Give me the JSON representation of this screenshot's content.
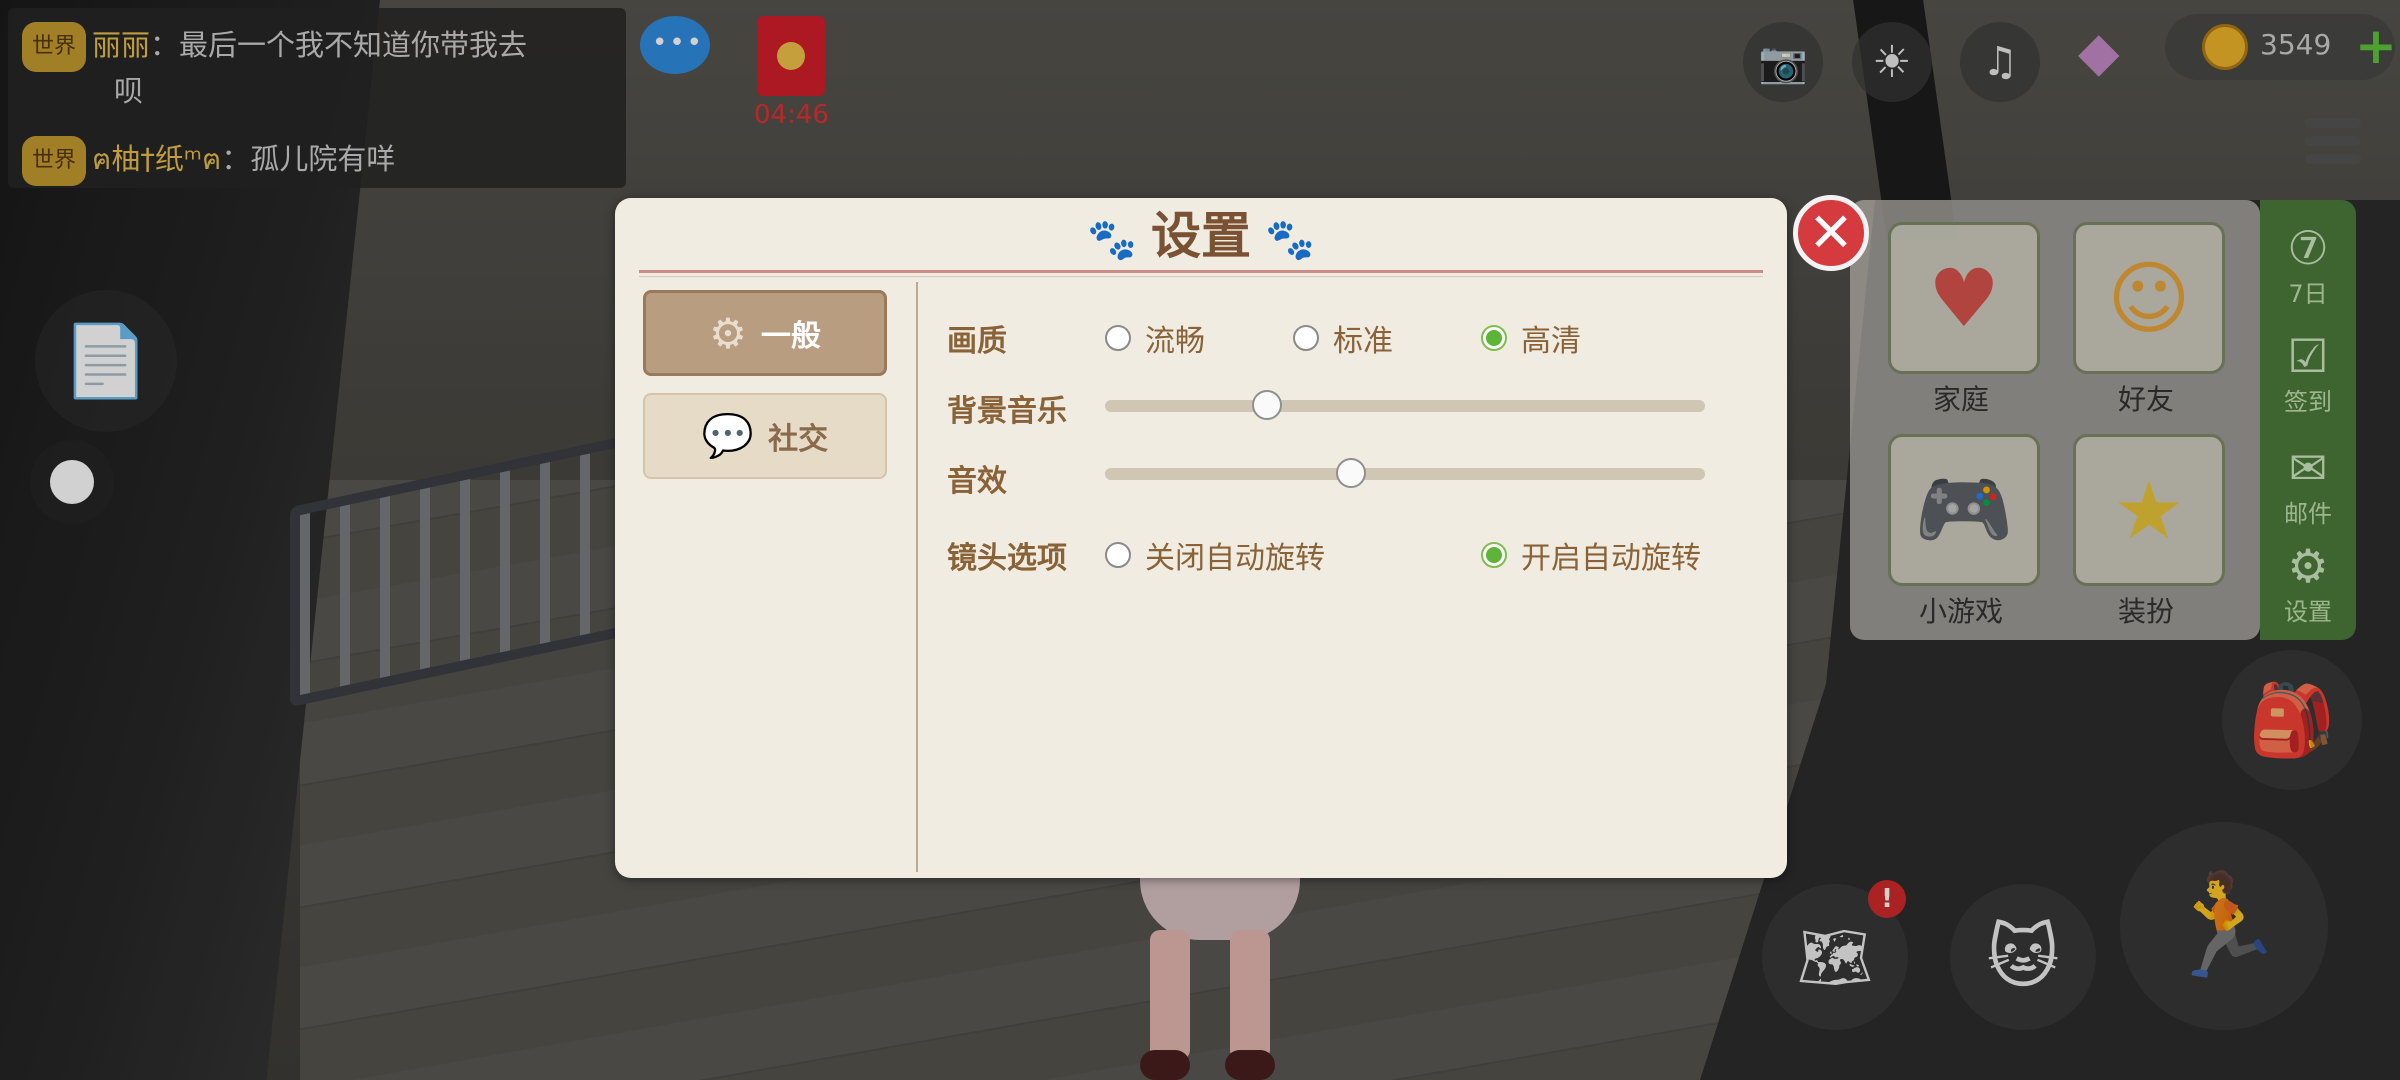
{
  "chat": {
    "messages": [
      {
        "channel": "世界",
        "sender": "丽丽",
        "sep": "：",
        "text_line1": "最后一个我不知道你带我去",
        "text_line2": "呗"
      },
      {
        "channel": "世界",
        "sender": "ฅ柚†纸ᵐฅ",
        "sep": "：",
        "text_line1": "孤儿院有咩"
      }
    ]
  },
  "redpacket_timer": "04:46",
  "currency": {
    "coins": "3549"
  },
  "right_panel": {
    "cards": [
      {
        "label": "家庭",
        "icon": "heart-face-icon"
      },
      {
        "label": "好友",
        "icon": "friends-icon"
      },
      {
        "label": "小游戏",
        "icon": "gamepad-icon"
      },
      {
        "label": "装扮",
        "icon": "magic-wand-icon"
      }
    ],
    "side_items": [
      {
        "label": "7日",
        "icon": "seven-day-icon"
      },
      {
        "label": "签到",
        "icon": "calendar-check-icon"
      },
      {
        "label": "邮件",
        "icon": "mail-icon"
      },
      {
        "label": "设置",
        "icon": "gear-icon"
      }
    ]
  },
  "map_alert": "!",
  "settings": {
    "title": "设置",
    "tabs": [
      {
        "label": "一般",
        "icon": "gears-icon",
        "active": true
      },
      {
        "label": "社交",
        "icon": "chat-bubbles-icon",
        "active": false
      }
    ],
    "quality": {
      "label": "画质",
      "options": [
        {
          "label": "流畅",
          "selected": false
        },
        {
          "label": "标准",
          "selected": false
        },
        {
          "label": "高清",
          "selected": true
        }
      ]
    },
    "bgm": {
      "label": "背景音乐",
      "value": 0.27
    },
    "sfx": {
      "label": "音效",
      "value": 0.41
    },
    "camera": {
      "label": "镜头选项",
      "options": [
        {
          "label": "关闭自动旋转",
          "selected": false
        },
        {
          "label": "开启自动旋转",
          "selected": true
        }
      ]
    }
  },
  "colors": {
    "accent_green": "#5db436",
    "title_brown": "#7a5132",
    "close_red": "#d53b3e"
  }
}
